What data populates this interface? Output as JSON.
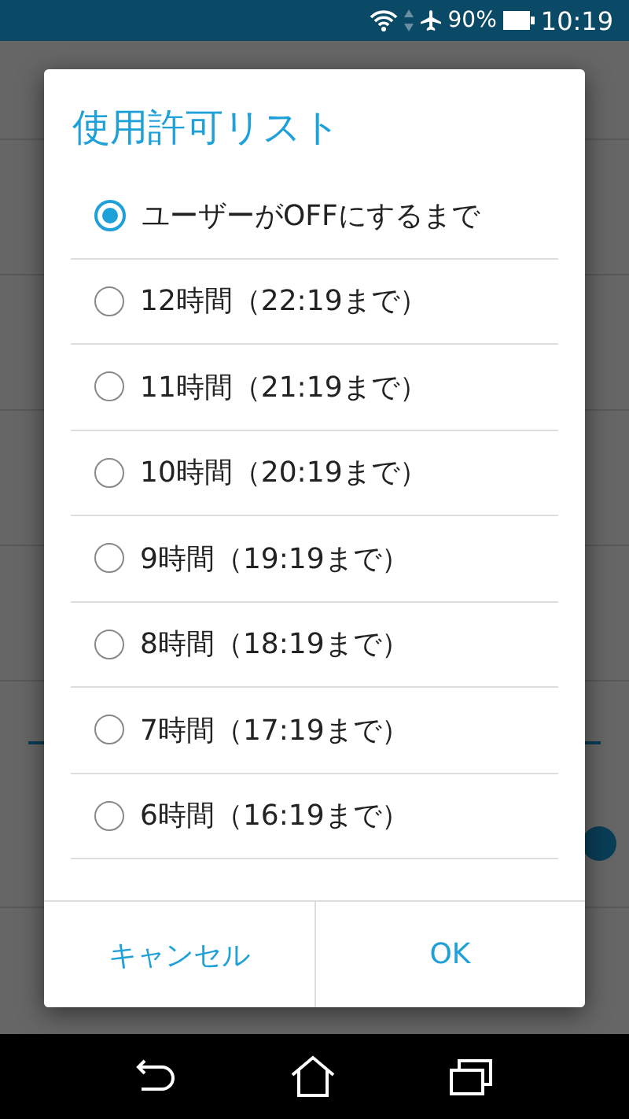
{
  "status_bar": {
    "battery": "90%",
    "time": "10:19"
  },
  "background": {
    "rows": [
      {
        "kind": "setting"
      },
      {
        "kind": "setting"
      },
      {
        "kind": "setting"
      },
      {
        "kind": "setting"
      },
      {
        "kind": "section"
      },
      {
        "kind": "switch",
        "on": true
      }
    ]
  },
  "dialog": {
    "title": "使用許可リスト",
    "options": [
      {
        "label": "ユーザーがOFFにするまで",
        "selected": true
      },
      {
        "label": "12時間（22:19まで）",
        "selected": false
      },
      {
        "label": "11時間（21:19まで）",
        "selected": false
      },
      {
        "label": "10時間（20:19まで）",
        "selected": false
      },
      {
        "label": "9時間（19:19まで）",
        "selected": false
      },
      {
        "label": "8時間（18:19まで）",
        "selected": false
      },
      {
        "label": "7時間（17:19まで）",
        "selected": false
      },
      {
        "label": "6時間（16:19まで）",
        "selected": false
      }
    ],
    "buttons": [
      "キャンセル",
      "OK"
    ]
  }
}
